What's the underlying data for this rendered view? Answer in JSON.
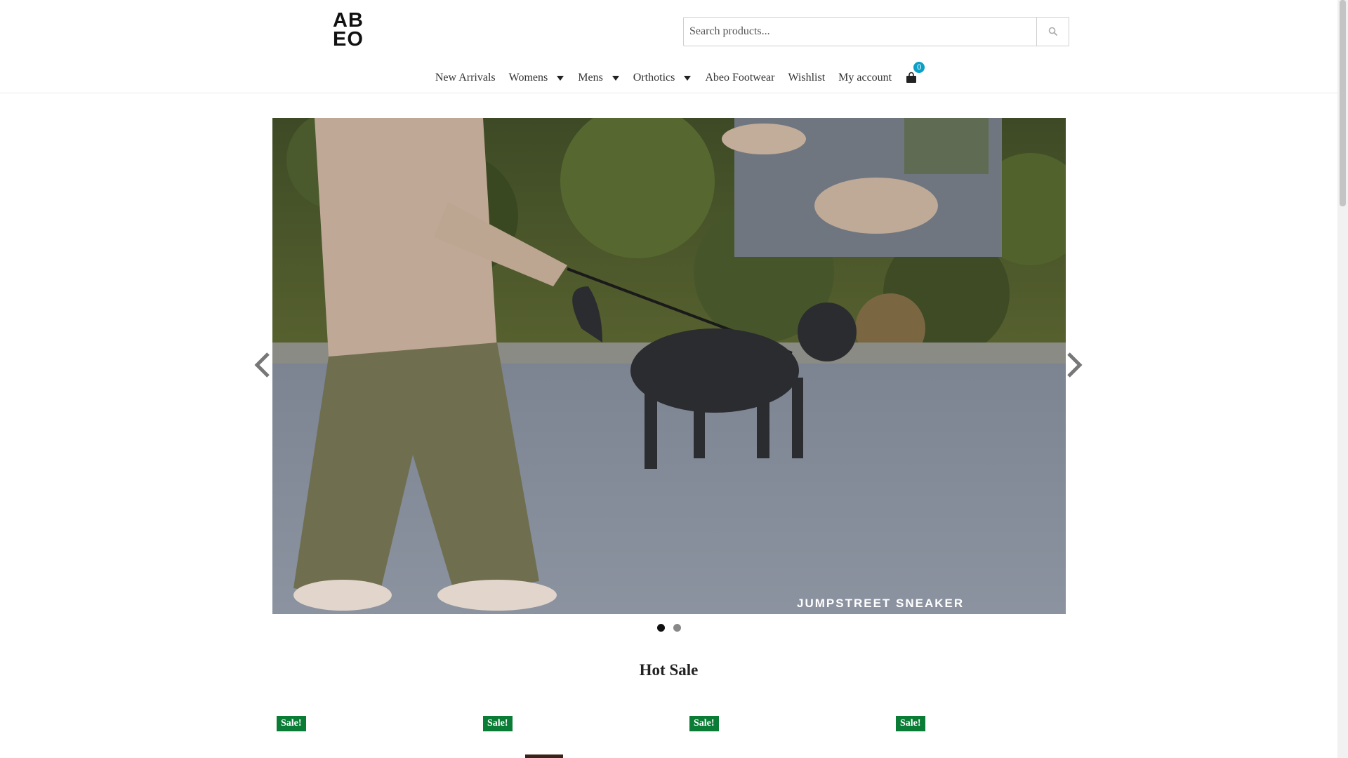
{
  "logo": {
    "line1": "AB",
    "line2": "EO"
  },
  "search": {
    "placeholder": "Search products...",
    "icon": "search-icon"
  },
  "nav": {
    "items": [
      {
        "label": "New Arrivals",
        "dropdown": false
      },
      {
        "label": "Womens",
        "dropdown": true
      },
      {
        "label": "Mens",
        "dropdown": true
      },
      {
        "label": "Orthotics",
        "dropdown": true
      },
      {
        "label": "Abeo Footwear",
        "dropdown": false
      },
      {
        "label": "Wishlist",
        "dropdown": false
      },
      {
        "label": "My account",
        "dropdown": false
      }
    ],
    "cart": {
      "icon": "shopping-bag-icon",
      "count": "0"
    }
  },
  "slider": {
    "caption": "JUMPSTREET SNEAKER",
    "slides": 2,
    "active_slide": 1,
    "prev_icon": "chevron-left-icon",
    "next_icon": "chevron-right-icon"
  },
  "hot_sale": {
    "title": "Hot Sale"
  },
  "products": [
    {
      "badge": "Sale!"
    },
    {
      "badge": "Sale!"
    },
    {
      "badge": "Sale!"
    },
    {
      "badge": "Sale!"
    }
  ],
  "colors": {
    "badge": "#0b7c35",
    "cart_badge": "#0aa0c8"
  }
}
